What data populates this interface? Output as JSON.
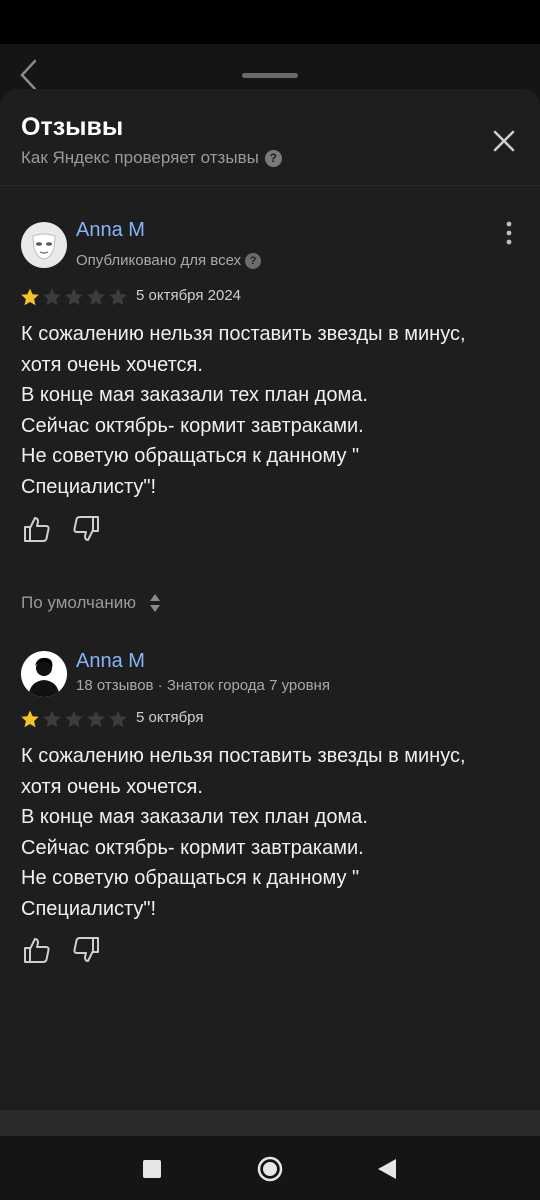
{
  "sheet": {
    "title": "Отзывы",
    "subtitle": "Как Яндекс проверяет отзывы"
  },
  "my_review": {
    "author": "Anna M",
    "status": "Опубликовано для всех",
    "rating": 1,
    "max_rating": 5,
    "date": "5 октября 2024",
    "text": "К сожалению нельзя поставить звезды в минус,\nхотя очень хочется.\nВ конце мая заказали тех план дома.\nСейчас октябрь- кормит завтраками.\nНе советую обращаться к данному \"\nСпециалисту\"!"
  },
  "sort": {
    "label": "По умолчанию"
  },
  "reviews": [
    {
      "author": "Anna M",
      "meta": "18 отзывов · Знаток города 7 уровня",
      "rating": 1,
      "max_rating": 5,
      "date": "5 октября",
      "text": "К сожалению нельзя поставить звезды в минус,\nхотя очень хочется.\nВ конце мая заказали тех план дома.\nСейчас октябрь- кормит завтраками.\nНе советую обращаться к данному \"\nСпециалисту\"!"
    }
  ],
  "icons": {
    "back": "chevron-left-icon",
    "close": "close-icon",
    "help": "question-circle-icon",
    "more": "more-vertical-icon",
    "like": "thumbs-up-icon",
    "dislike": "thumbs-down-icon",
    "sort": "sort-arrows-icon",
    "nav_recent": "square-icon",
    "nav_home": "circle-icon",
    "nav_back": "triangle-back-icon"
  },
  "colors": {
    "background": "#1e1e1e",
    "author": "#8ab4f8",
    "star_filled": "#f6c229",
    "star_empty": "#3c3c3c"
  }
}
